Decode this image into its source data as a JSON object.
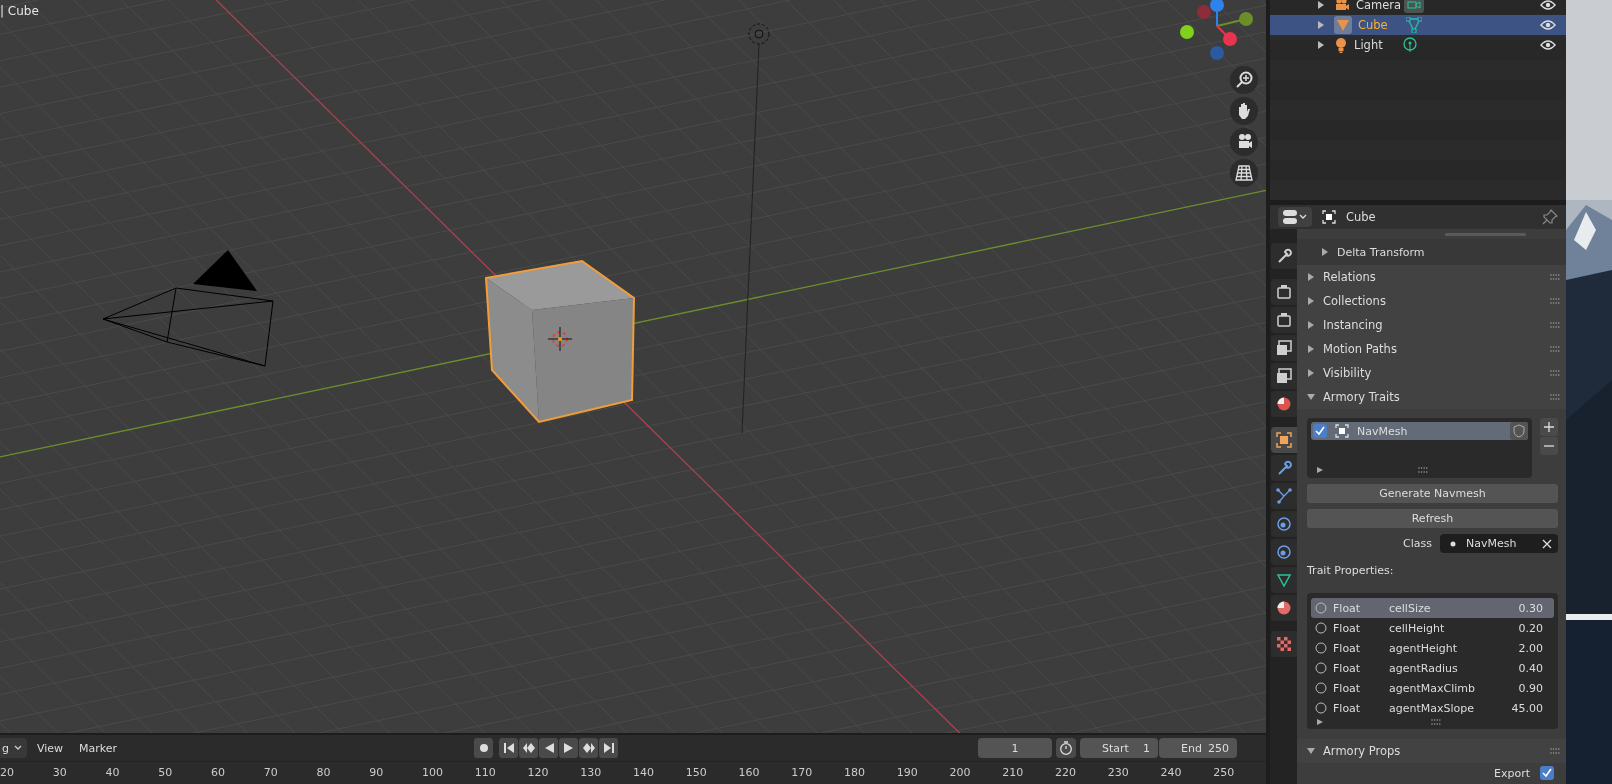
{
  "viewport": {
    "object_label": "| Cube"
  },
  "outliner": {
    "rows": [
      {
        "name": "Camera",
        "kind": "camera",
        "selected": false
      },
      {
        "name": "Cube",
        "kind": "mesh",
        "selected": true
      },
      {
        "name": "Light",
        "kind": "light",
        "selected": false
      }
    ]
  },
  "properties": {
    "object_name": "Cube",
    "tabs": [
      {
        "kind": "tool",
        "selected": false
      },
      {
        "kind": "render",
        "selected": false
      },
      {
        "kind": "output",
        "selected": false
      },
      {
        "kind": "view_layer",
        "selected": false
      },
      {
        "kind": "scene",
        "selected": false
      },
      {
        "kind": "world",
        "selected": false
      },
      {
        "kind": "object",
        "selected": true
      },
      {
        "kind": "modifier",
        "selected": false
      },
      {
        "kind": "particles",
        "selected": false
      },
      {
        "kind": "physics",
        "selected": false
      },
      {
        "kind": "constraints",
        "selected": false
      },
      {
        "kind": "data",
        "selected": false
      },
      {
        "kind": "material",
        "selected": false
      },
      {
        "kind": "texture",
        "selected": false
      }
    ],
    "subpanel": {
      "label": "Delta Transform",
      "expanded": false
    },
    "panels": [
      {
        "label": "Relations",
        "expanded": false
      },
      {
        "label": "Collections",
        "expanded": false
      },
      {
        "label": "Instancing",
        "expanded": false
      },
      {
        "label": "Motion Paths",
        "expanded": false
      },
      {
        "label": "Visibility",
        "expanded": false
      },
      {
        "label": "Armory Traits",
        "expanded": true
      }
    ],
    "traits": [
      {
        "name": "NavMesh",
        "checked": true,
        "selected": true
      }
    ],
    "buttons": [
      "Generate Navmesh",
      "Refresh"
    ],
    "class_field": {
      "label": "Class",
      "value": "NavMesh"
    },
    "trait_properties_label": "Trait Properties:",
    "trait_properties": [
      {
        "type": "Float",
        "name": "cellSize",
        "value": "0.30",
        "selected": true
      },
      {
        "type": "Float",
        "name": "cellHeight",
        "value": "0.20",
        "selected": false
      },
      {
        "type": "Float",
        "name": "agentHeight",
        "value": "2.00",
        "selected": false
      },
      {
        "type": "Float",
        "name": "agentRadius",
        "value": "0.40",
        "selected": false
      },
      {
        "type": "Float",
        "name": "agentMaxClimb",
        "value": "0.90",
        "selected": false
      },
      {
        "type": "Float",
        "name": "agentMaxSlope",
        "value": "45.00",
        "selected": false
      }
    ],
    "armory_props": {
      "label": "Armory Props",
      "expanded": true,
      "export_label": "Export",
      "export_checked": true
    }
  },
  "timeline": {
    "menu": [
      {
        "label": "g",
        "kind": "dropdown"
      },
      {
        "label": "View",
        "kind": "menu"
      },
      {
        "label": "Marker",
        "kind": "menu"
      }
    ],
    "current_frame": "1",
    "start_label": "Start",
    "start": "1",
    "end_label": "End",
    "end": "250",
    "ruler": [
      "20",
      "30",
      "40",
      "50",
      "60",
      "70",
      "80",
      "90",
      "100",
      "110",
      "120",
      "130",
      "140",
      "150",
      "160",
      "170",
      "180",
      "190",
      "200",
      "210",
      "220",
      "230",
      "240",
      "250"
    ]
  }
}
